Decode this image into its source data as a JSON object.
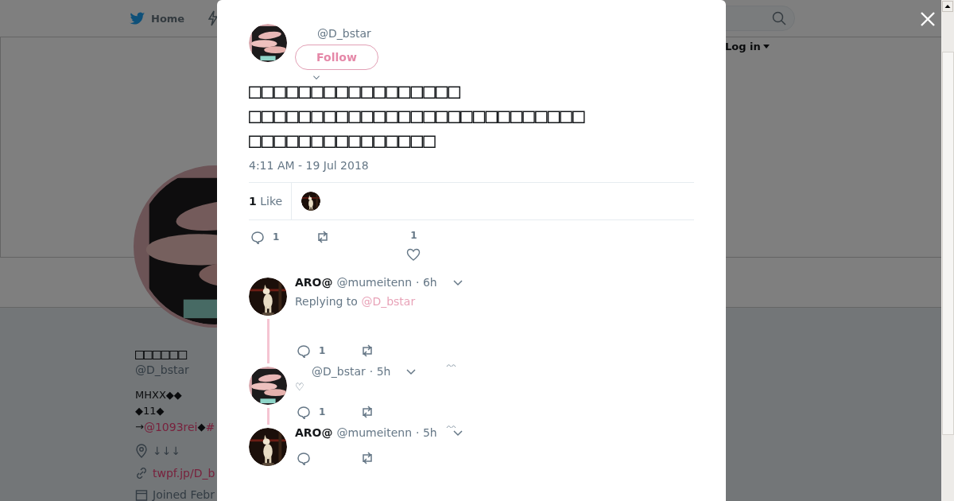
{
  "nav": {
    "home": "Home",
    "login": "Log in"
  },
  "profile": {
    "name": "□□□□□□",
    "handle": "@D_bstar",
    "bio": [
      [
        {
          "kind": "plain",
          "text": "MHXX◆◆"
        }
      ],
      [
        {
          "kind": "plain",
          "text": "◆11◆"
        }
      ],
      [
        {
          "kind": "plain",
          "text": "→"
        },
        {
          "kind": "link",
          "text": "@1093rei"
        },
        {
          "kind": "plain",
          "text": "◆"
        },
        {
          "kind": "link",
          "text": "#"
        }
      ]
    ],
    "location": "↓↓↓",
    "url": "twpf.jp/D_b",
    "joined": "Joined Febr"
  },
  "tweet": {
    "handle": "@D_bstar",
    "follow": "Follow",
    "text": "□□□□□□□□□□□□□□□□□\n□□□□□□□□□□□□□□□□□□□□□□□□□□□\n□□□□□□□□□□□□□□□",
    "time": "4:11 AM - 19 Jul 2018",
    "likes_count": "1",
    "likes_label": "Like",
    "reply_count": "1",
    "like_count": "1"
  },
  "replies": [
    {
      "name": "ARO@",
      "handle": "@mumeitenn",
      "time": "· 6h",
      "replying_label": "Replying to",
      "replying_handle": "@D_bstar",
      "reply_count": "1"
    },
    {
      "handle": "@D_bstar",
      "time": "· 5h",
      "text": "♡",
      "reply_count": "1"
    },
    {
      "name": "ARO@",
      "handle": "@mumeitenn",
      "time": "· 5h"
    }
  ]
}
